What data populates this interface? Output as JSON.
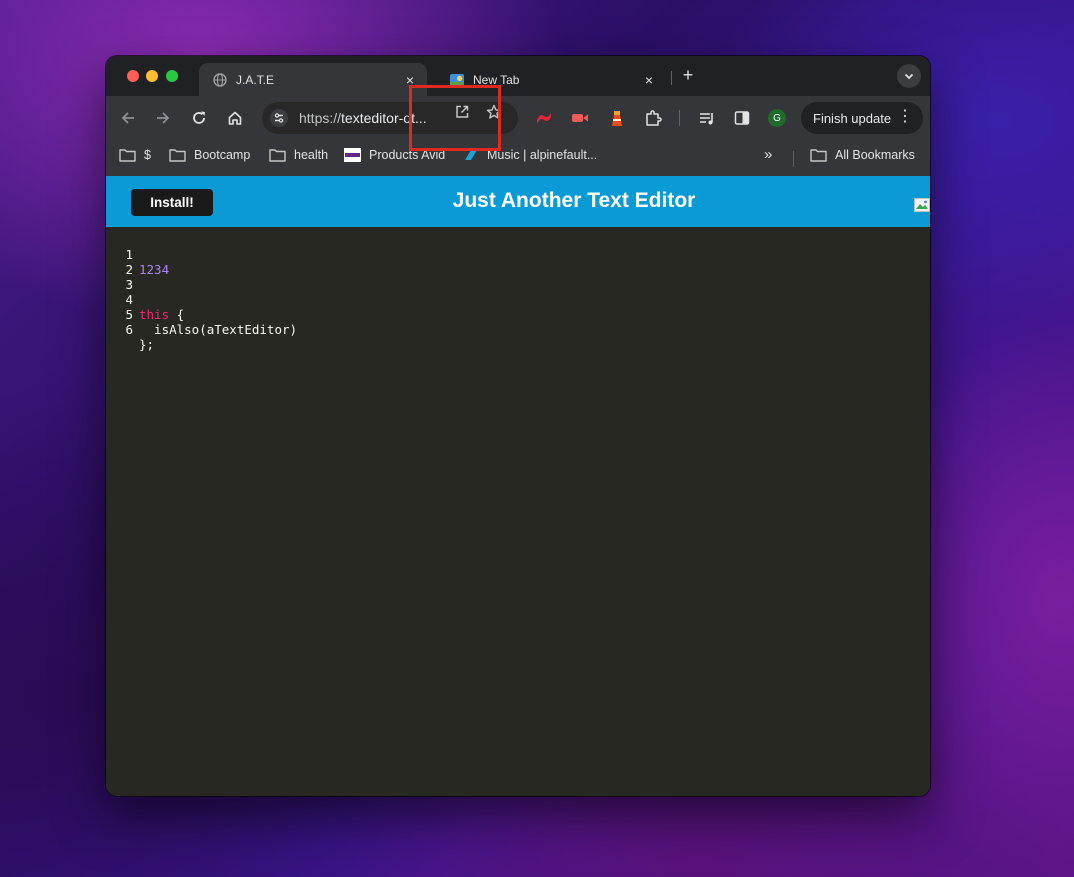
{
  "browser": {
    "tabs": [
      {
        "title": "J.A.T.E",
        "active": true
      },
      {
        "title": "New Tab",
        "active": false
      }
    ],
    "new_tab_label": "+",
    "close_label": "×",
    "url_prefix": "https://",
    "url_host": "texteditor-ot...",
    "finish_update_label": "Finish update",
    "profile_initial": "G",
    "bookmarks": [
      {
        "label": "$",
        "icon": "folder-icon"
      },
      {
        "label": "Bootcamp",
        "icon": "folder-icon"
      },
      {
        "label": "health",
        "icon": "folder-icon"
      },
      {
        "label": "Products Avid",
        "icon": "avid-favicon"
      },
      {
        "label": "Music | alpinefault...",
        "icon": "music-favicon"
      }
    ],
    "bookmarks_overflow": "»",
    "all_bookmarks_label": "All Bookmarks"
  },
  "app": {
    "install_label": "Install!",
    "title": "Just Another Text Editor",
    "header_color": "#0a9ad6"
  },
  "editor": {
    "lines": [
      {
        "n": "1",
        "text": "1234"
      },
      {
        "n": "2",
        "text": ""
      },
      {
        "n": "3",
        "text": ""
      },
      {
        "n": "4",
        "keyword": "this",
        "text": " {"
      },
      {
        "n": "5",
        "text": "  isAlso(aTextEditor)"
      },
      {
        "n": "6",
        "text": "};"
      }
    ],
    "colors": {
      "background": "#272822",
      "number": "#ae81ff",
      "keyword": "#f92672",
      "text": "#f8f8f2"
    }
  },
  "annotation": {
    "color": "#e0291f",
    "target": "open-in-app-icon"
  }
}
